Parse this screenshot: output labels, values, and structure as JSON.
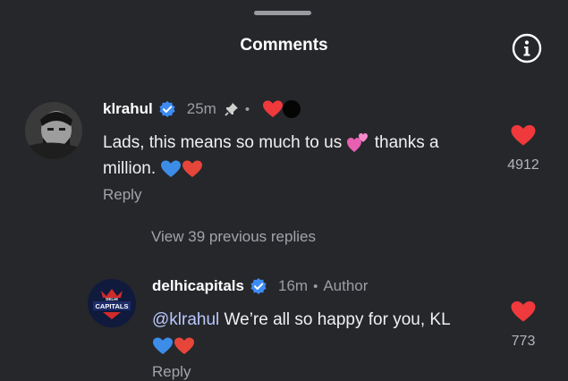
{
  "header": {
    "title": "Comments",
    "info_icon": "info-icon"
  },
  "comments": [
    {
      "username": "klrahul",
      "time": "25m",
      "text_line1": "Lads, this means so much to us",
      "text_line1_after": "thanks a",
      "text_line2": "million.",
      "reply_label": "Reply",
      "likes": "4912"
    },
    {
      "view_replies": "View 39 previous replies",
      "username": "delhicapitals",
      "time": "16m",
      "author_tag": "Author",
      "mention": "@klrahul",
      "text": "We’re all so happy for you, KL",
      "reply_label": "Reply",
      "likes": "773",
      "avatar_text": "CAPITALS"
    }
  ],
  "colors": {
    "background": "#26272b",
    "verified": "#3d8bf5",
    "like": "#f0393c"
  }
}
